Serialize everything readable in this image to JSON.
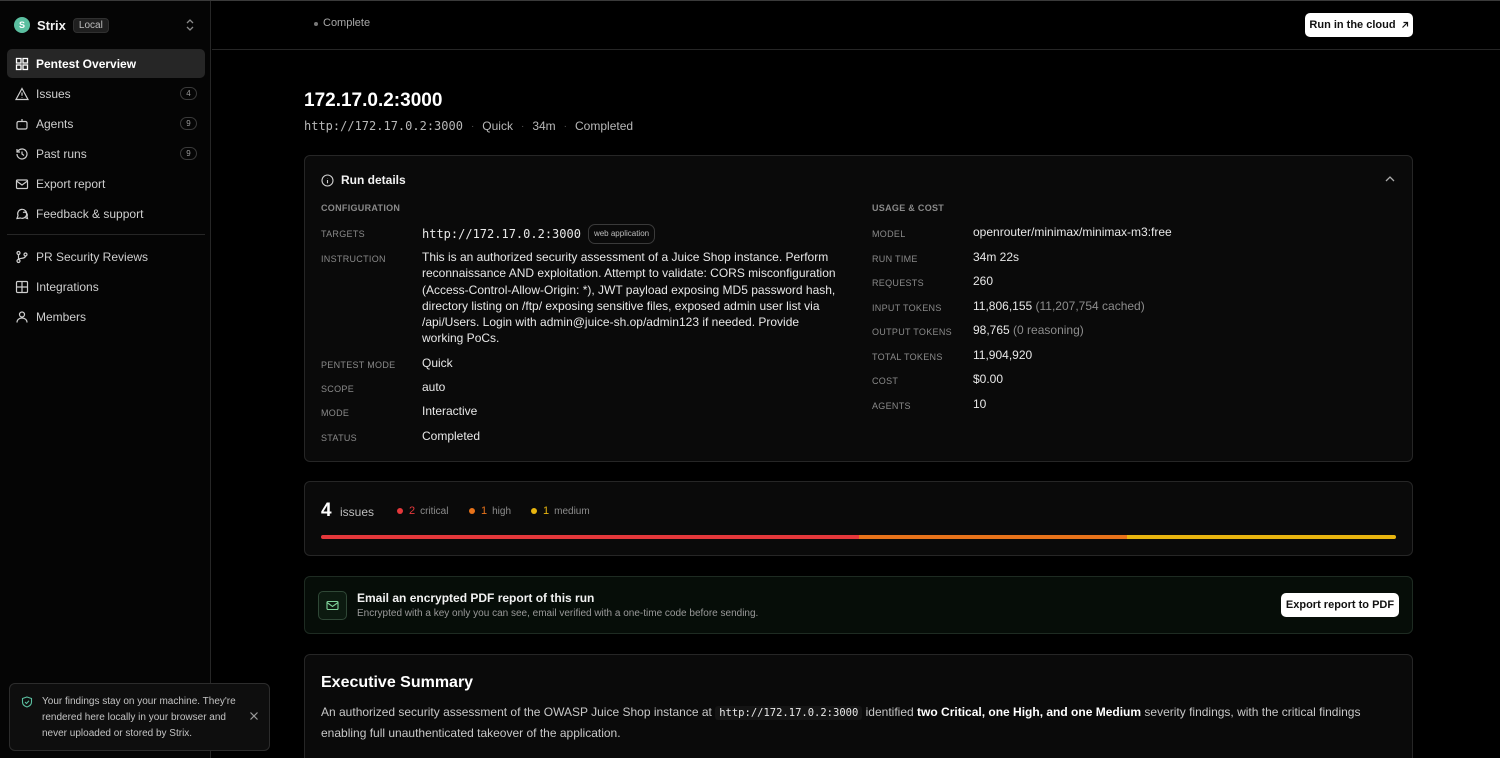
{
  "app": {
    "name": "Strix",
    "badge": "Local",
    "logo_letter": "S"
  },
  "sidebar": {
    "items": [
      {
        "label": "Pentest Overview",
        "icon": "grid-icon",
        "active": true
      },
      {
        "label": "Issues",
        "icon": "warning-icon",
        "count": "4"
      },
      {
        "label": "Agents",
        "icon": "bot-icon",
        "count": "9"
      },
      {
        "label": "Past runs",
        "icon": "history-icon",
        "count": "9"
      },
      {
        "label": "Export report",
        "icon": "mail-icon"
      },
      {
        "label": "Feedback & support",
        "icon": "chat-icon"
      }
    ],
    "items2": [
      {
        "label": "PR Security Reviews",
        "icon": "git-branch-icon"
      },
      {
        "label": "Integrations",
        "icon": "blocks-icon"
      },
      {
        "label": "Members",
        "icon": "user-icon"
      }
    ],
    "notice": "Your findings stay on your machine. They're rendered here locally in your browser and never uploaded or stored by Strix."
  },
  "topbar": {
    "status": "Complete",
    "cloud_button": "Run in the cloud"
  },
  "header": {
    "title": "172.17.0.2:3000",
    "url": "http://172.17.0.2:3000",
    "mode": "Quick",
    "duration": "34m",
    "status": "Completed"
  },
  "run_details": {
    "title": "Run details",
    "config_label": "CONFIGURATION",
    "usage_label": "USAGE & COST",
    "config": {
      "targets_label": "TARGETS",
      "targets_value": "http://172.17.0.2:3000",
      "targets_tag": "web application",
      "instruction_label": "INSTRUCTION",
      "instruction_value": "This is an authorized security assessment of a Juice Shop instance. Perform reconnaissance AND exploitation. Attempt to validate: CORS misconfiguration (Access-Control-Allow-Origin: *), JWT payload exposing MD5 password hash, directory listing on /ftp/ exposing sensitive files, exposed admin user list via /api/Users. Login with admin@juice-sh.op/admin123 if needed. Provide working PoCs.",
      "pentest_mode_label": "PENTEST MODE",
      "pentest_mode_value": "Quick",
      "scope_label": "SCOPE",
      "scope_value": "auto",
      "mode_label": "MODE",
      "mode_value": "Interactive",
      "status_label": "STATUS",
      "status_value": "Completed"
    },
    "usage": {
      "model_label": "MODEL",
      "model_value": "openrouter/minimax/minimax-m3:free",
      "run_time_label": "RUN TIME",
      "run_time_value": "34m 22s",
      "requests_label": "REQUESTS",
      "requests_value": "260",
      "input_tokens_label": "INPUT TOKENS",
      "input_tokens_value": "11,806,155",
      "input_tokens_extra": "(11,207,754 cached)",
      "output_tokens_label": "OUTPUT TOKENS",
      "output_tokens_value": "98,765",
      "output_tokens_extra": "(0 reasoning)",
      "total_tokens_label": "TOTAL TOKENS",
      "total_tokens_value": "11,904,920",
      "cost_label": "COST",
      "cost_value": "$0.00",
      "agents_label": "AGENTS",
      "agents_value": "10"
    }
  },
  "issues": {
    "count": "4",
    "word": "issues",
    "severities": [
      {
        "count": "2",
        "label": "critical",
        "color": "#e5383b",
        "share": 0.5
      },
      {
        "count": "1",
        "label": "high",
        "color": "#e8731a",
        "share": 0.25
      },
      {
        "count": "1",
        "label": "medium",
        "color": "#e8b50f",
        "share": 0.25
      }
    ]
  },
  "email": {
    "title": "Email an encrypted PDF report of this run",
    "subtitle": "Encrypted with a key only you can see, email verified with a one-time code before sending.",
    "button": "Export report to PDF"
  },
  "summary": {
    "title": "Executive Summary",
    "text_1": "An authorized security assessment of the OWASP Juice Shop instance at",
    "code": "http://172.17.0.2:3000",
    "text_2": "identified",
    "bold": "two Critical, one High, and one Medium",
    "text_3": "severity findings, with the critical findings enabling full unauthenticated takeover of the application."
  }
}
